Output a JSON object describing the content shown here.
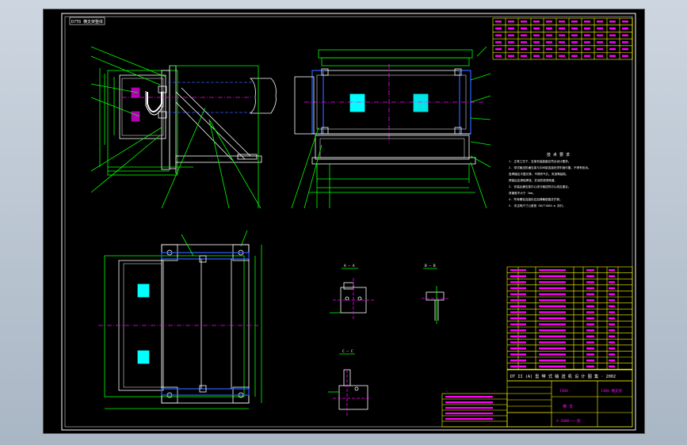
{
  "drawing": {
    "label_box": "D7T8 横支架整体",
    "tech_requirements": {
      "title": "技  术  要  求",
      "items": [
        "1. 正常工况下，支架安装高度应符合设计要求。",
        "2. 带式输送机横支架与中间架连接处须牢固可靠，不得有松动。",
        "   各焊缝应平整光滑，不得有气孔、夹渣等缺陷。",
        "   焊接后应清除焊渣，并涂防锈漆两道。",
        "3. 安装后横支架中心线与输送机中心线应重合。",
        "   其偏差不大于 2mm。",
        "4. 所有螺栓连接处应加弹簧垫圈并拧紧。",
        "5. 未注明尺寸公差按 GB/T1804-m 执行。"
      ]
    },
    "title_block": {
      "main_title": "DT II (A) 型 带 式 输 送 机 设 计 图 集 · 2002",
      "drawing_no": "1400",
      "sheet_info": "1400 横支架",
      "name_label": "横 支",
      "bottom_code": "A-2000-一 图"
    },
    "section_labels": [
      "A — A",
      "B — B",
      "C — C"
    ],
    "colors": {
      "background": "#000000",
      "outline": "#ffffff",
      "dimension": "#00ff00",
      "table": "#ffff00",
      "text": "#ff00ff",
      "centerline": "#ff00ff",
      "hidden": "#0000ff",
      "fill": "#00ffff",
      "frame": "#ffffff"
    }
  }
}
